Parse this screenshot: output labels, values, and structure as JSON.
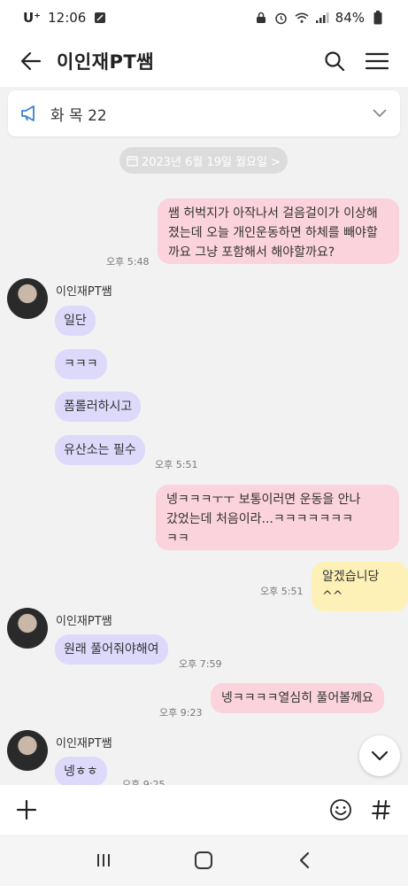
{
  "status_bar": {
    "carrier": "U⁺",
    "time": "12:06",
    "battery": "84%"
  },
  "header": {
    "title": "이인재PT쌤"
  },
  "notice": {
    "text": "화 목 22"
  },
  "date_chip": {
    "label": "2023년 6월 19일 월요일 >"
  },
  "messages": [
    {
      "sender": "me",
      "text_lines": [
        "쌤 허벅지가 아작나서 걸음걸이가 이상해",
        "졌는데 오늘 개인운동하면 하체를 빼야할",
        "까요 그냥 포함해서 해야할까요?"
      ],
      "time": "오후 5:48"
    },
    {
      "sender": "them",
      "name": "이인재PT쌤",
      "text": "일단"
    },
    {
      "sender": "them",
      "text": "ㅋㅋㅋ"
    },
    {
      "sender": "them",
      "text": "폼롤러하시고"
    },
    {
      "sender": "them",
      "text": "유산소는 필수",
      "time": "오후 5:51"
    },
    {
      "sender": "me",
      "text_lines": [
        "넹ㅋㅋㅋㅜㅜ 보통이러면 운동을 안나",
        "갔었는데 처음이라...ㅋㅋㅋㅋㅋㅋㅋ",
        "ㅋㅋ"
      ]
    },
    {
      "sender": "me",
      "text": "알겠습니당^^",
      "time": "오후 5:51"
    },
    {
      "sender": "them",
      "name": "이인재PT쌤",
      "text": "원래 풀어줘야해여",
      "time": "오후 7:59"
    },
    {
      "sender": "me",
      "text": "넹ㅋㅋㅋㅋ열심히 풀어볼께요",
      "time": "오후 9:23"
    },
    {
      "sender": "them",
      "name": "이인재PT쌤",
      "text": "넹ㅎㅎ",
      "time": "오후 9:25"
    }
  ],
  "colors": {
    "my_bubble": "#fbd3dc",
    "my_bubble_alt": "#fdf1b8",
    "their_bubble": "#dcd9fb",
    "background": "#f2f2f2"
  }
}
